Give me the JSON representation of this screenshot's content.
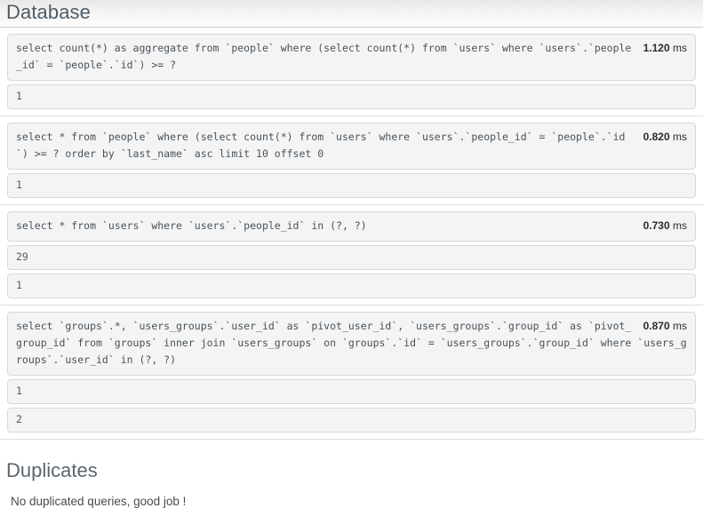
{
  "database_section": {
    "title": "Database",
    "queries": [
      {
        "sql": "select count(*) as aggregate from `people` where (select count(*) from `users` where `users`.`people_id` = `people`.`id`) >= ?",
        "time_value": "1.120",
        "time_unit": "ms",
        "bindings": [
          "1"
        ]
      },
      {
        "sql": "select * from `people` where (select count(*) from `users` where `users`.`people_id` = `people`.`id`) >= ? order by `last_name` asc limit 10 offset 0",
        "time_value": "0.820",
        "time_unit": "ms",
        "bindings": [
          "1"
        ]
      },
      {
        "sql": "select * from `users` where `users`.`people_id` in (?, ?)",
        "time_value": "0.730",
        "time_unit": "ms",
        "bindings": [
          "29",
          "1"
        ]
      },
      {
        "sql": "select `groups`.*, `users_groups`.`user_id` as `pivot_user_id`, `users_groups`.`group_id` as `pivot_group_id` from `groups` inner join `users_groups` on `groups`.`id` = `users_groups`.`group_id` where `users_groups`.`user_id` in (?, ?)",
        "time_value": "0.870",
        "time_unit": "ms",
        "bindings": [
          "1",
          "2"
        ]
      }
    ]
  },
  "duplicates_section": {
    "title": "Duplicates",
    "message": "No duplicated queries, good job !"
  }
}
